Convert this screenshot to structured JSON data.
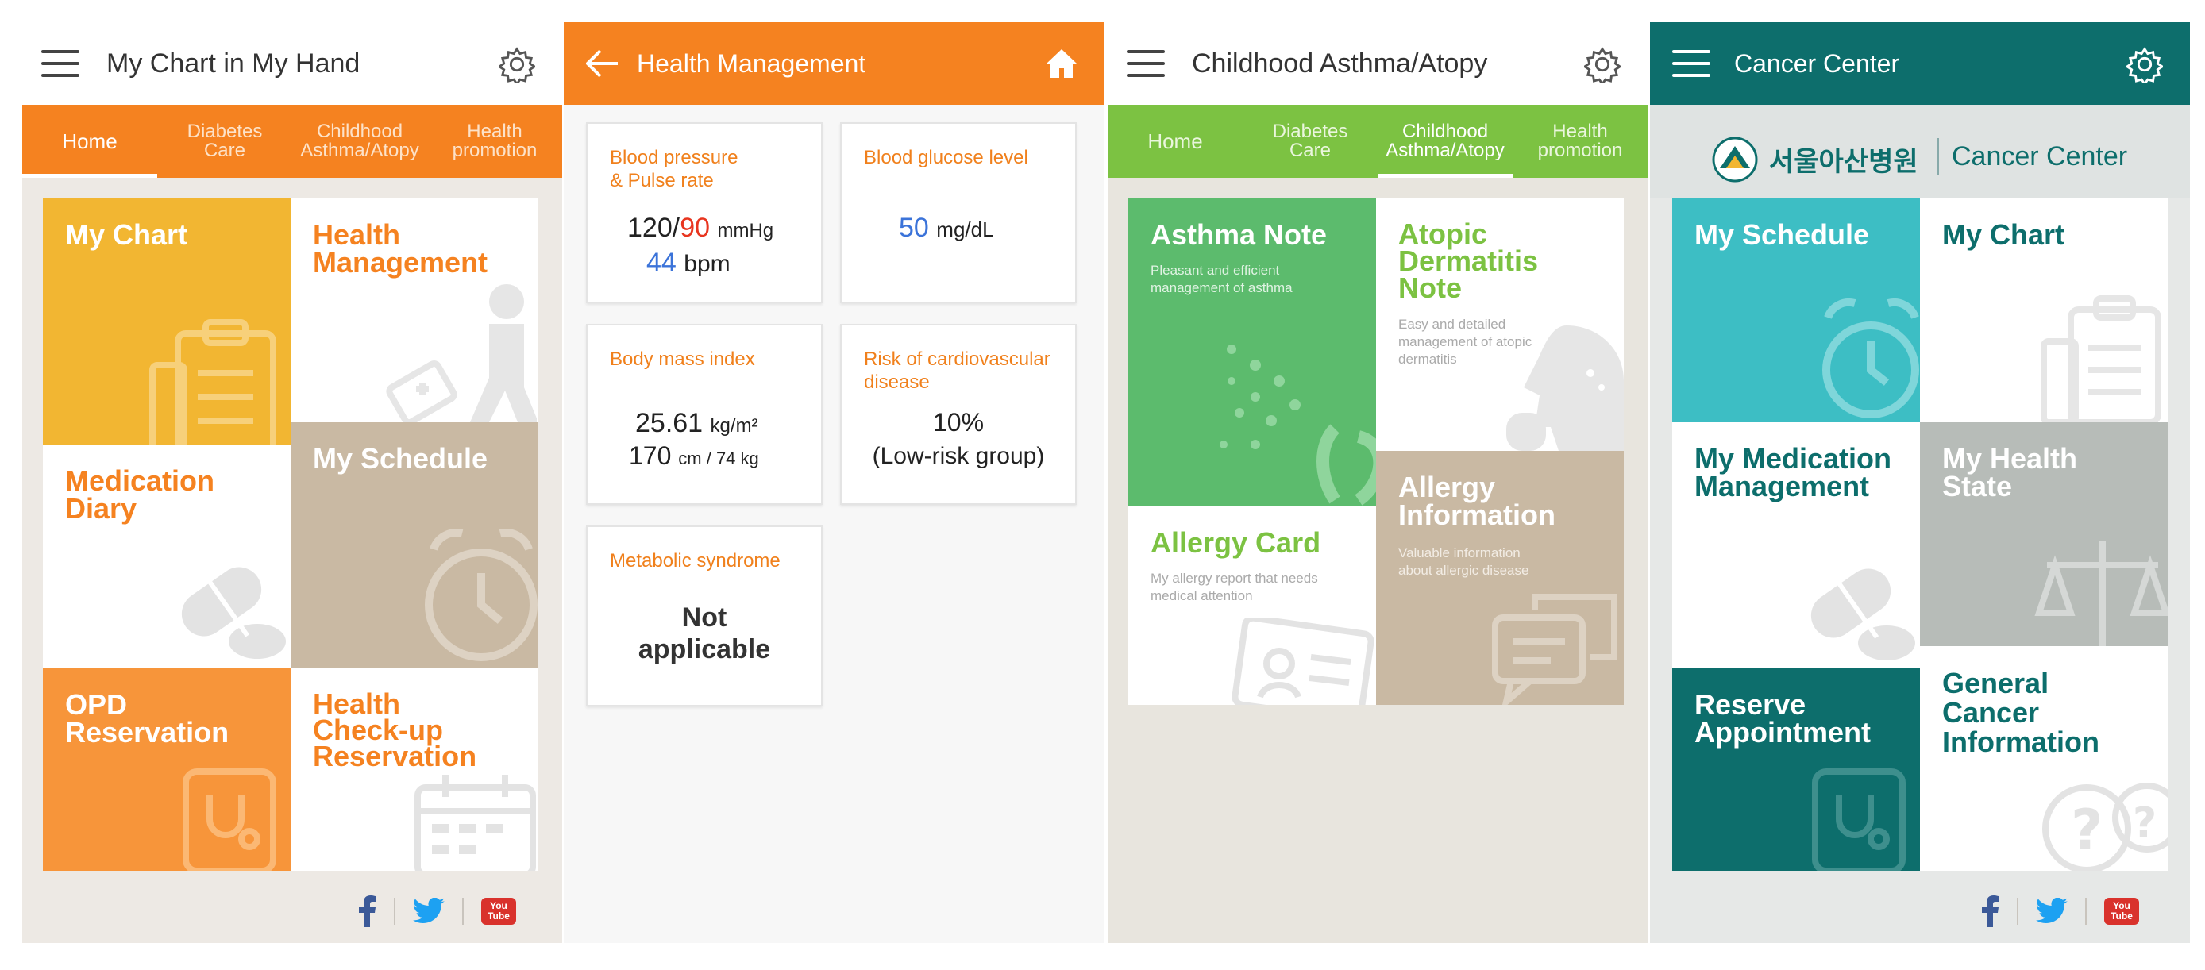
{
  "screen1": {
    "title": "My Chart in My Hand",
    "tabs": [
      {
        "line1": "Home",
        "line2": ""
      },
      {
        "line1": "Diabetes",
        "line2": "Care"
      },
      {
        "line1": "Childhood",
        "line2": "Asthma/Atopy"
      },
      {
        "line1": "Health",
        "line2": "promotion"
      }
    ],
    "tiles": {
      "my_chart": "My Chart",
      "health_mgmt": [
        "Health",
        "Management"
      ],
      "medication": [
        "Medication",
        "Diary"
      ],
      "schedule": "My Schedule",
      "opd": [
        "OPD",
        "Reservation"
      ],
      "checkup": [
        "Health",
        "Check-up",
        "Reservation"
      ]
    }
  },
  "screen2": {
    "title": "Health Management",
    "cards": {
      "bp_label": [
        "Blood pressure",
        "& Pulse rate"
      ],
      "bp_sys": "120/",
      "bp_dia": "90",
      "bp_unit": "mmHg",
      "pulse": "44",
      "pulse_unit": "bpm",
      "glucose_label": "Blood glucose level",
      "glucose": "50",
      "glucose_unit": "mg/dL",
      "bmi_label": "Body mass index",
      "bmi": "25.61",
      "bmi_unit": "kg/m²",
      "height": "170",
      "height_unit": "cm / 74 kg",
      "risk_label": [
        "Risk of cardiovascular",
        "disease"
      ],
      "risk_value": "10%",
      "risk_group": "(Low-risk group)",
      "metabolic_label": "Metabolic syndrome",
      "metabolic_value": [
        "Not",
        "applicable"
      ]
    }
  },
  "screen3": {
    "title": "Childhood Asthma/Atopy",
    "tabs": [
      {
        "line1": "Home",
        "line2": ""
      },
      {
        "line1": "Diabetes",
        "line2": "Care"
      },
      {
        "line1": "Childhood",
        "line2": "Asthma/Atopy"
      },
      {
        "line1": "Health",
        "line2": "promotion"
      }
    ],
    "tiles": {
      "asthma_title": "Asthma Note",
      "asthma_sub": [
        "Pleasant and efficient",
        "management of asthma"
      ],
      "atopic_title": [
        "Atopic",
        "Dermatitis",
        "Note"
      ],
      "atopic_sub": [
        "Easy and detailed",
        "management of atopic",
        "dermatitis"
      ],
      "allergy_card_title": "Allergy Card",
      "allergy_card_sub": [
        "My allergy report that needs",
        "medical attention"
      ],
      "allergy_info_title": [
        "Allergy",
        "Information"
      ],
      "allergy_info_sub": [
        "Valuable information",
        "about allergic disease"
      ]
    }
  },
  "screen4": {
    "title": "Cancer Center",
    "logo_korean": "서울아산병원",
    "logo_text": "Cancer Center",
    "tiles": {
      "schedule": "My Schedule",
      "chart": "My Chart",
      "medication": [
        "My Medication",
        "Management"
      ],
      "health_state": [
        "My Health",
        "State"
      ],
      "reserve": [
        "Reserve",
        "Appointment"
      ],
      "general": [
        "General",
        "Cancer",
        "Information"
      ]
    }
  },
  "social": {
    "youtube_line1": "You",
    "youtube_line2": "Tube"
  },
  "colors": {
    "orange": "#f58220",
    "green": "#7cc242",
    "teal": "#0d6e6c",
    "gold": "#f2b632",
    "taupe": "#c9b9a3",
    "cyan": "#3dbec4",
    "gray": "#b7bcb8"
  }
}
